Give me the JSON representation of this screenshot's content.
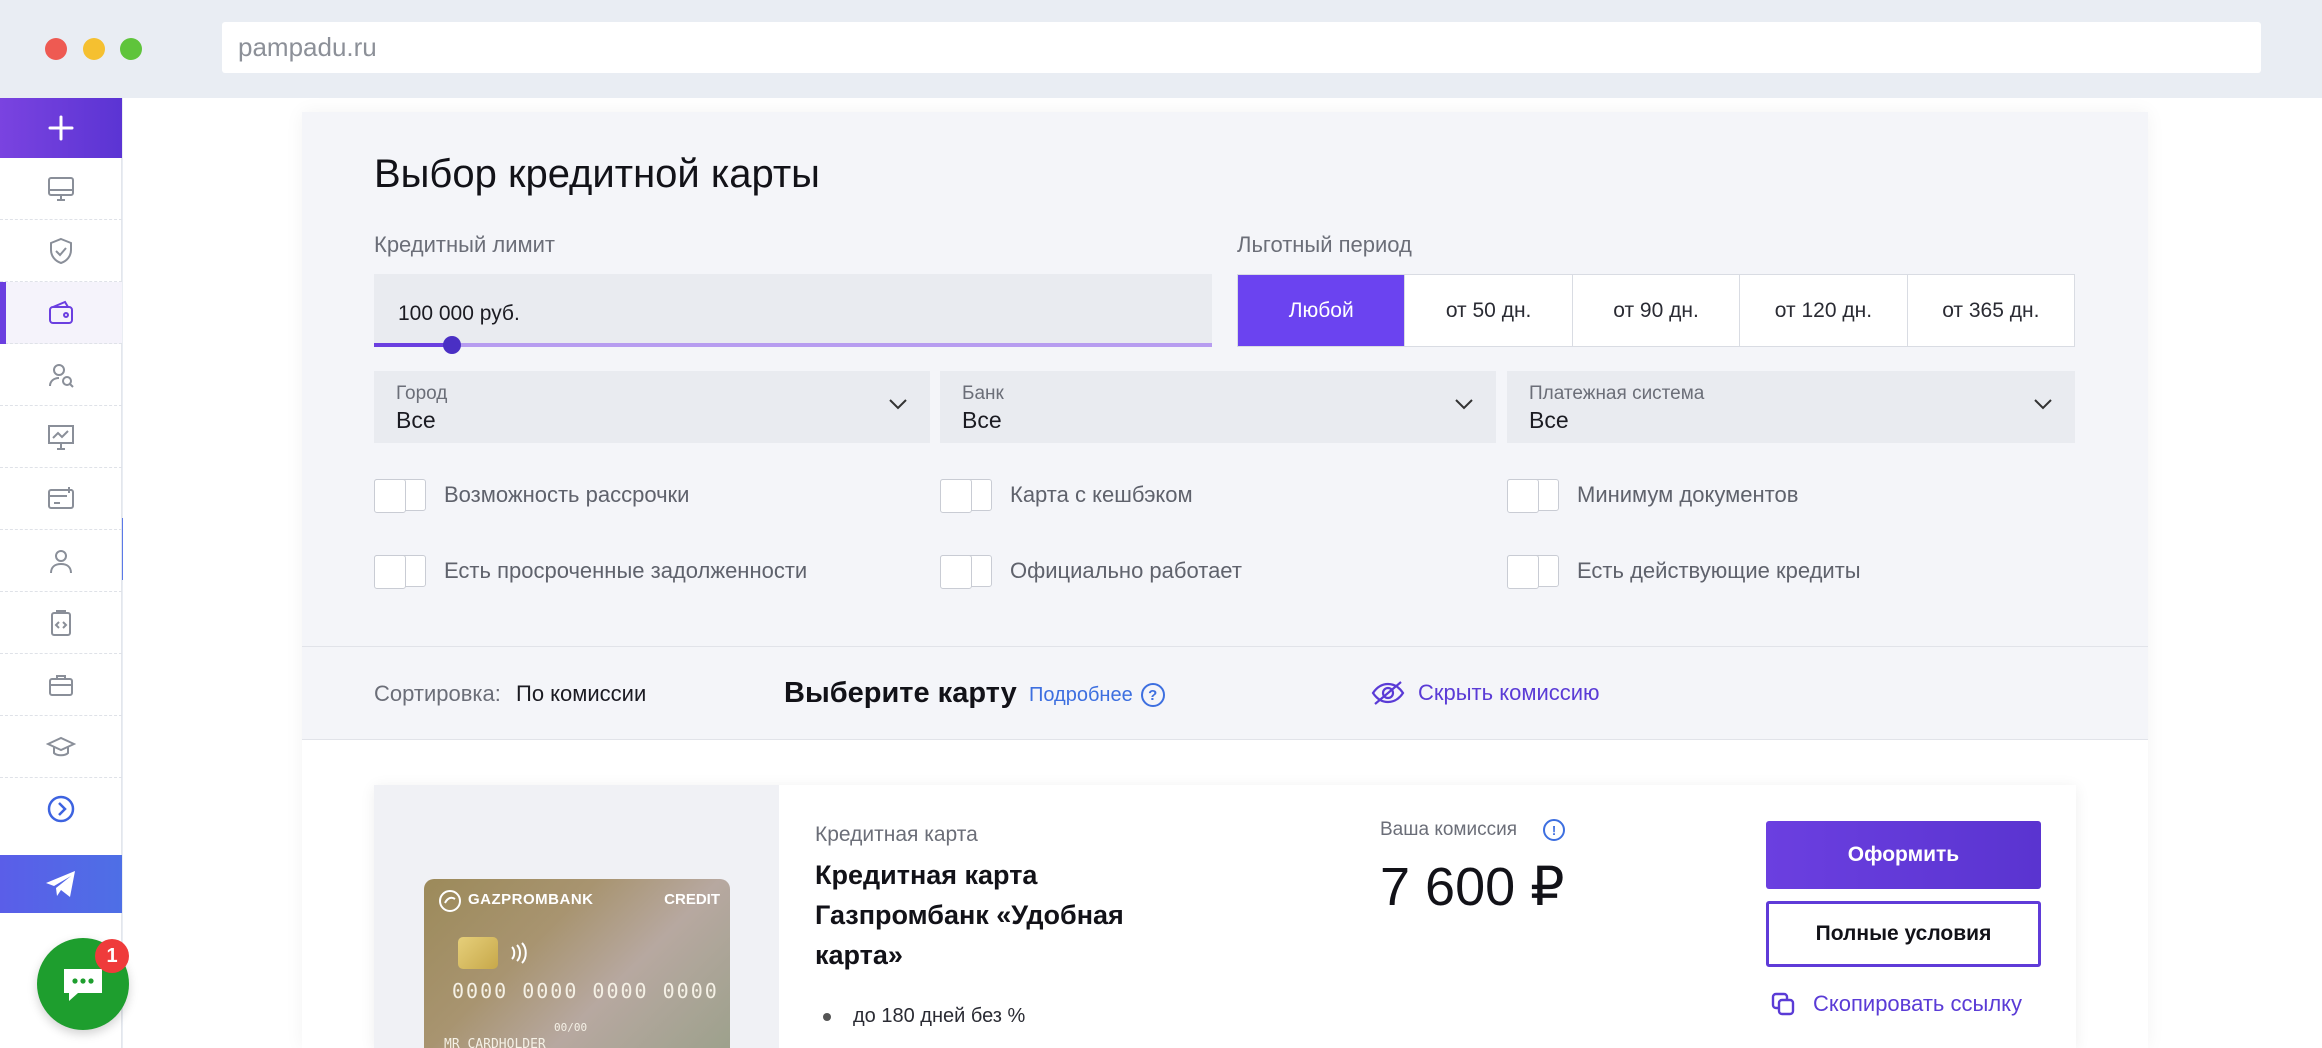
{
  "browser": {
    "url": "pampadu.ru"
  },
  "sidebar": {
    "items": [
      {
        "icon": "monitor-icon"
      },
      {
        "icon": "shield-check-icon"
      },
      {
        "icon": "wallet-icon",
        "active": true
      },
      {
        "icon": "user-search-icon"
      },
      {
        "icon": "presentation-chart-icon"
      },
      {
        "icon": "card-plus-icon"
      },
      {
        "icon": "user-icon"
      },
      {
        "icon": "clipboard-code-icon"
      },
      {
        "icon": "briefcase-icon"
      },
      {
        "icon": "graduation-cap-icon"
      },
      {
        "icon": "arrow-circle-icon"
      }
    ],
    "chat_badge": "1"
  },
  "page": {
    "title": "Выбор кредитной карты",
    "credit_limit": {
      "label": "Кредитный лимит",
      "value": "100 000 руб.",
      "slider_fraction": 0.08
    },
    "grace_period": {
      "label": "Льготный период",
      "options": [
        "Любой",
        "от 50 дн.",
        "от 90 дн.",
        "от 120 дн.",
        "от 365 дн."
      ],
      "selected": "Любой"
    },
    "filters": {
      "city": {
        "label": "Город",
        "value": "Все"
      },
      "bank": {
        "label": "Банк",
        "value": "Все"
      },
      "payment_system": {
        "label": "Платежная система",
        "value": "Все"
      }
    },
    "toggles": [
      "Возможность рассрочки",
      "Карта с кешбэком",
      "Минимум документов",
      "Есть просроченные задолженности",
      "Официально работает",
      "Есть действующие кредиты"
    ]
  },
  "sortbar": {
    "sort_label": "Сортировка:",
    "sort_value": "По комиссии",
    "choose_title": "Выберите карту",
    "more_link": "Подробнее",
    "hide_commission": "Скрыть комиссию"
  },
  "offer": {
    "type": "Кредитная карта",
    "name": "Кредитная карта Газпромбанк «Удобная карта»",
    "bullet": "до 180 дней без %",
    "commission_label": "Ваша комиссия",
    "commission_value": "7 600 ₽",
    "apply_button": "Оформить",
    "terms_button": "Полные условия",
    "copy_link": "Скопировать ссылку",
    "card_image": {
      "bank": "GAZPROMBANK",
      "badge": "CREDIT",
      "number": "0000 0000 0000 0000",
      "expiry": "00/00",
      "holder": "MR CARDHOLDER"
    }
  },
  "colors": {
    "accent": "#6b3fe0",
    "link": "#3d6fe0",
    "chat": "#1e9e2e"
  }
}
